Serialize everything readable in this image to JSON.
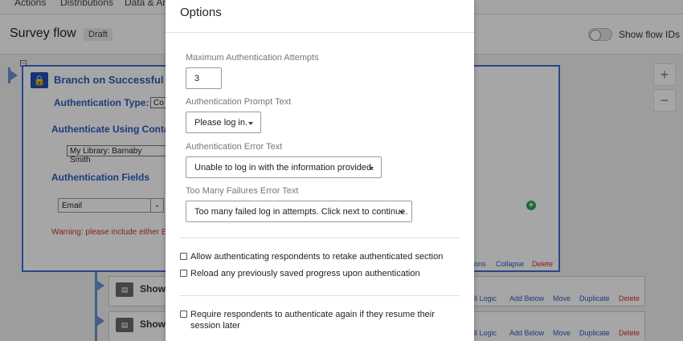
{
  "tabs": [
    "Actions",
    "Distributions",
    "Data & Ana"
  ],
  "header": {
    "title": "Survey flow",
    "draft_badge": "Draft",
    "show_flow_ids_label": "Show flow IDs"
  },
  "branch": {
    "title": "Branch on Successful Aut",
    "auth_type_label": "Authentication Type:",
    "auth_type_value": "Co",
    "authenticate_using_label": "Authenticate Using Conta",
    "library_value": "My Library: Barnaby Smith",
    "auth_fields_label": "Authentication Fields",
    "field_value": "Email",
    "warning": "Warning: please include either Em",
    "actions": [
      "ons",
      "Collapse",
      "Delete"
    ]
  },
  "blocks": [
    {
      "label": "Show",
      "actions": [
        "ill Logic",
        "Add Below",
        "Move",
        "Duplicate",
        "Delete"
      ]
    },
    {
      "label": "Show",
      "actions": [
        "ill Logic",
        "Add Below",
        "Move",
        "Duplicate",
        "Delete"
      ]
    }
  ],
  "zoom": {
    "in_icon": "plus-icon",
    "out_icon": "minus-icon"
  },
  "modal": {
    "title": "Options",
    "max_attempts_label": "Maximum Authentication Attempts",
    "max_attempts_value": "3",
    "prompt_label": "Authentication Prompt Text",
    "prompt_value": "Please log in.",
    "error_label": "Authentication Error Text",
    "error_value": "Unable to log in with the information provided.",
    "failures_label": "Too Many Failures Error Text",
    "failures_value": "Too many failed log in attempts. Click next to continue.",
    "checkboxes": [
      {
        "label": "Allow authenticating respondents to retake authenticated section",
        "checked": false
      },
      {
        "label": "Reload any previously saved progress upon authentication",
        "checked": false
      },
      {
        "label": "Require respondents to authenticate again if they resume their session later",
        "checked": false
      }
    ]
  },
  "colors": {
    "accent": "#3d6fd1",
    "warning": "#cc3333",
    "delete": "#d62b2b",
    "add": "#2da44e"
  }
}
